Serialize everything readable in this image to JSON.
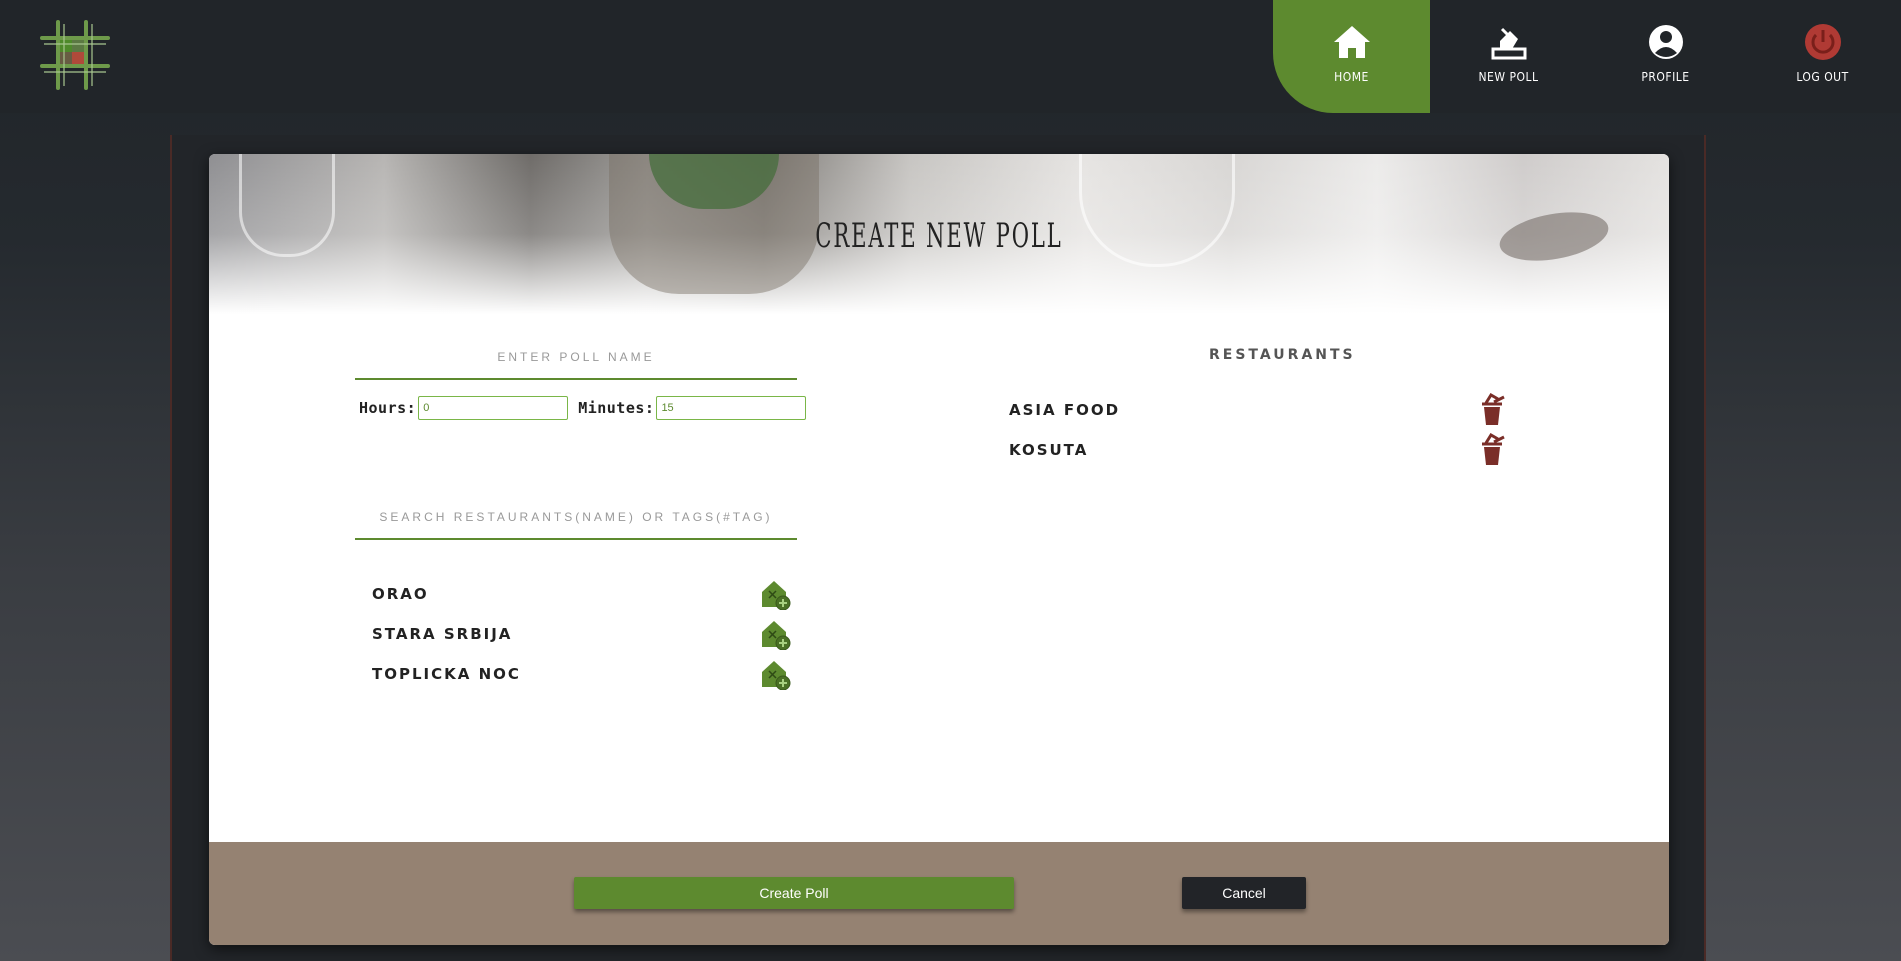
{
  "nav": {
    "items": [
      {
        "label": "HOME",
        "icon": "home-icon",
        "active": true
      },
      {
        "label": "NEW POLL",
        "icon": "new-poll-icon",
        "active": false
      },
      {
        "label": "PROFILE",
        "icon": "profile-icon",
        "active": false
      },
      {
        "label": "LOG OUT",
        "icon": "power-icon",
        "active": false
      }
    ]
  },
  "colors": {
    "accent": "#5d8a2f",
    "logout": "#b03a34",
    "footer": "#958272",
    "danger": "#7a2e28"
  },
  "form": {
    "title": "CREATE NEW POLL",
    "poll_name_placeholder": "ENTER POLL NAME",
    "hours_label": "Hours:",
    "hours_value": "0",
    "minutes_label": "Minutes:",
    "minutes_value": "15",
    "search_placeholder": "SEARCH RESTAURANTS(NAME) OR TAGS(#TAG)"
  },
  "available_restaurants": [
    {
      "name": "ORAO",
      "icon": "add-restaurant-icon"
    },
    {
      "name": "STARA SRBIJA",
      "icon": "add-restaurant-icon"
    },
    {
      "name": "TOPLICKA NOC",
      "icon": "add-restaurant-icon"
    }
  ],
  "selected": {
    "heading": "RESTAURANTS",
    "items": [
      {
        "name": "ASIA FOOD",
        "icon": "remove-icon"
      },
      {
        "name": "KOSUTA",
        "icon": "remove-icon"
      }
    ]
  },
  "actions": {
    "create_label": "Create Poll",
    "cancel_label": "Cancel"
  }
}
